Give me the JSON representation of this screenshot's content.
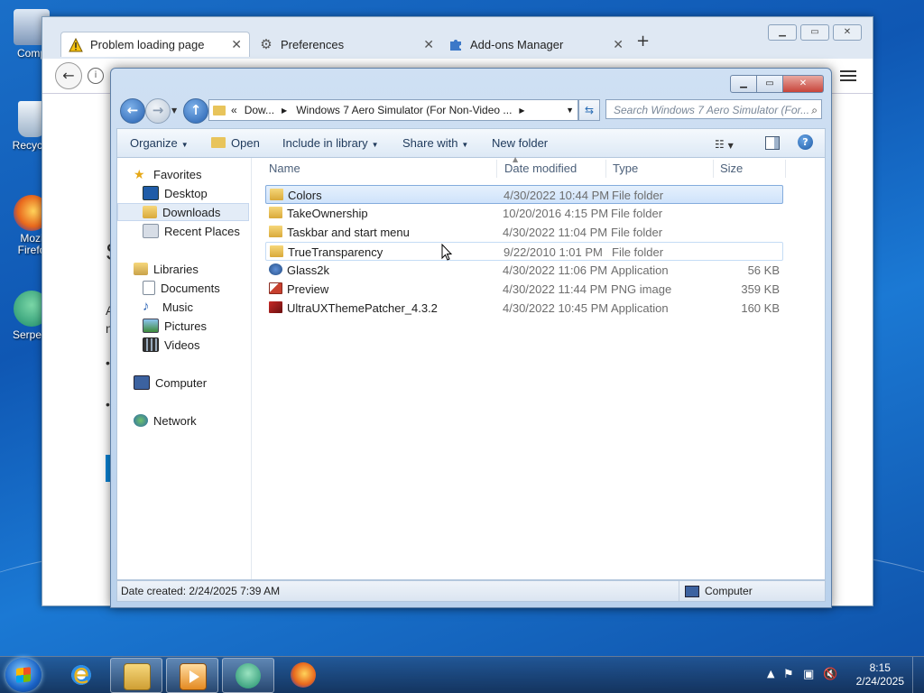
{
  "desktop": {
    "icons": [
      {
        "label": "Comp",
        "name": "computer"
      },
      {
        "label": "Recycle",
        "name": "recycle-bin"
      },
      {
        "label": "Mozi Firefo",
        "name": "mozilla-firefox"
      },
      {
        "label": "Serpent",
        "name": "serpent"
      }
    ]
  },
  "firefox": {
    "tabs": [
      {
        "label": "Problem loading page",
        "icon": "warning-icon"
      },
      {
        "label": "Preferences",
        "icon": "gear-icon"
      },
      {
        "label": "Add-ons Manager",
        "icon": "puzzle-icon"
      }
    ],
    "new_tab": "+",
    "content_fragments": [
      "S",
      "A",
      "n",
      "•",
      "•"
    ]
  },
  "explorer": {
    "address": {
      "prefix": "«",
      "parts": [
        "Dow...",
        "Windows 7 Aero Simulator (For Non-Video ..."
      ]
    },
    "search_placeholder": "Search Windows 7 Aero Simulator (For...",
    "commands": {
      "organize": "Organize",
      "open": "Open",
      "include_in_library": "Include in library",
      "share_with": "Share with",
      "new_folder": "New folder"
    },
    "nav": {
      "favorites": "Favorites",
      "desktop": "Desktop",
      "downloads": "Downloads",
      "recent_places": "Recent Places",
      "libraries": "Libraries",
      "documents": "Documents",
      "music": "Music",
      "pictures": "Pictures",
      "videos": "Videos",
      "computer": "Computer",
      "network": "Network"
    },
    "columns": {
      "name": "Name",
      "date_modified": "Date modified",
      "type": "Type",
      "size": "Size"
    },
    "files": [
      {
        "name": "Colors",
        "date": "4/30/2022 10:44 PM",
        "type": "File folder",
        "size": "",
        "icon": "folder-icon",
        "state": "selected"
      },
      {
        "name": "TakeOwnership",
        "date": "10/20/2016 4:15 PM",
        "type": "File folder",
        "size": "",
        "icon": "folder-icon",
        "state": ""
      },
      {
        "name": "Taskbar and start menu",
        "date": "4/30/2022 11:04 PM",
        "type": "File folder",
        "size": "",
        "icon": "folder-icon",
        "state": ""
      },
      {
        "name": "TrueTransparency",
        "date": "9/22/2010 1:01 PM",
        "type": "File folder",
        "size": "",
        "icon": "folder-icon",
        "state": "hover"
      },
      {
        "name": "Glass2k",
        "date": "4/30/2022 11:06 PM",
        "type": "Application",
        "size": "56 KB",
        "icon": "application-icon",
        "state": ""
      },
      {
        "name": "Preview",
        "date": "4/30/2022 11:44 PM",
        "type": "PNG image",
        "size": "359 KB",
        "icon": "png-image-icon",
        "state": ""
      },
      {
        "name": "UltraUXThemePatcher_4.3.2",
        "date": "4/30/2022 10:45 PM",
        "type": "Application",
        "size": "160 KB",
        "icon": "patcher-icon",
        "state": ""
      }
    ],
    "status": {
      "left": "Date created: 2/24/2025 7:39 AM",
      "right": "Computer"
    }
  },
  "taskbar": {
    "time": "8:15",
    "date": "2/24/2025"
  }
}
